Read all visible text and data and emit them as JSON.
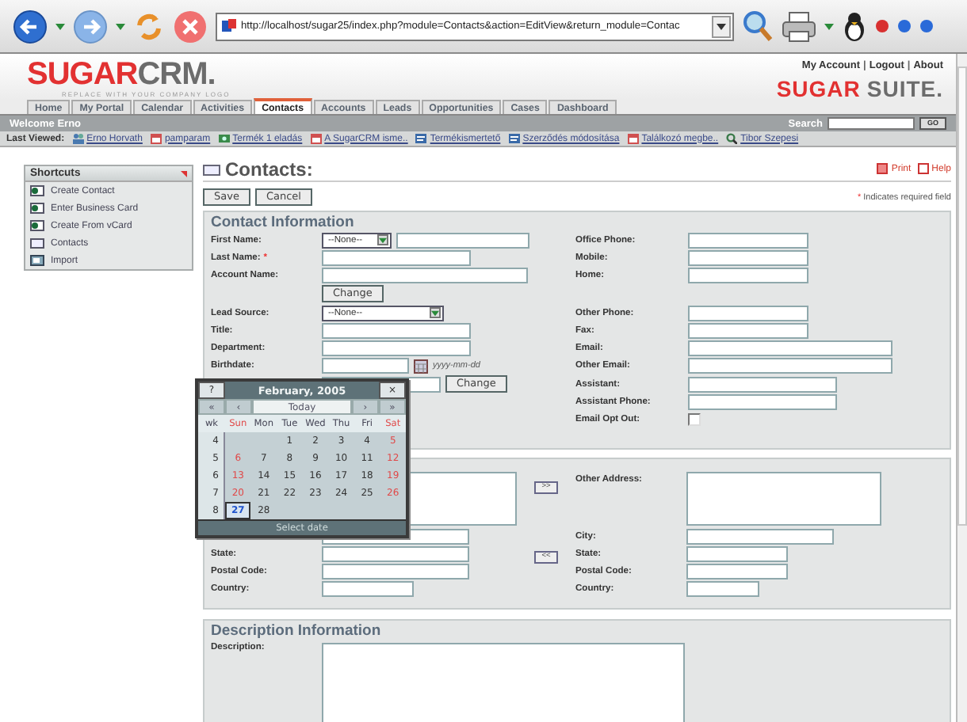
{
  "browser": {
    "url": "http://localhost/sugar25/index.php?module=Contacts&action=EditView&return_module=Contac"
  },
  "header": {
    "logo": {
      "accent": "SUGAR",
      "rest": "CRM."
    },
    "tagline": "REPLACE WITH YOUR COMPANY LOGO",
    "links": [
      "My Account",
      "Logout",
      "About"
    ],
    "separator": "|",
    "suite_logo": {
      "accent": "SUGAR",
      "rest": "SUITE."
    }
  },
  "tabs": [
    {
      "label": "Home",
      "selected": false
    },
    {
      "label": "My Portal",
      "selected": false
    },
    {
      "label": "Calendar",
      "selected": false
    },
    {
      "label": "Activities",
      "selected": false
    },
    {
      "label": "Contacts",
      "selected": true
    },
    {
      "label": "Accounts",
      "selected": false
    },
    {
      "label": "Leads",
      "selected": false
    },
    {
      "label": "Opportunities",
      "selected": false
    },
    {
      "label": "Cases",
      "selected": false
    },
    {
      "label": "Dashboard",
      "selected": false
    }
  ],
  "welcome": "Welcome Erno",
  "search": {
    "label": "Search",
    "button": "GO"
  },
  "last_viewed": {
    "label": "Last Viewed:",
    "items": [
      {
        "label": "Erno Horvath",
        "kind": "contact"
      },
      {
        "label": "pamparam",
        "kind": "meeting"
      },
      {
        "label": "Termék 1 eladás",
        "kind": "opportunity"
      },
      {
        "label": "A SugarCRM isme..",
        "kind": "meeting"
      },
      {
        "label": "Termékismertető",
        "kind": "note"
      },
      {
        "label": "Szerződés módosítása",
        "kind": "note"
      },
      {
        "label": "Találkozó megbe..",
        "kind": "meeting"
      },
      {
        "label": "Tibor Szepesi",
        "kind": "lead"
      }
    ]
  },
  "shortcuts": {
    "title": "Shortcuts",
    "items": [
      {
        "label": "Create Contact",
        "kind": "create"
      },
      {
        "label": "Enter Business Card",
        "kind": "create"
      },
      {
        "label": "Create From vCard",
        "kind": "create"
      },
      {
        "label": "Contacts",
        "kind": "list"
      },
      {
        "label": "Import",
        "kind": "import"
      }
    ]
  },
  "page": {
    "title": "Contacts:",
    "links": [
      "Print",
      "Help"
    ],
    "buttons": [
      "Save",
      "Cancel"
    ],
    "required_note": {
      "mark": "*",
      "text": "Indicates required field"
    }
  },
  "contact_panel": {
    "title": "Contact Information",
    "rows": [
      {
        "left": {
          "kind": "select_input",
          "label": "First Name:",
          "select": "--None--"
        },
        "right": {
          "kind": "input",
          "label": "Office Phone:"
        }
      },
      {
        "left": {
          "kind": "input",
          "label": "Last Name:",
          "required_mark": "*"
        },
        "right": {
          "kind": "input",
          "label": "Mobile:"
        }
      },
      {
        "left": {
          "kind": "input",
          "label": "Account Name:"
        },
        "right": {
          "kind": "input",
          "label": "Home:"
        }
      },
      {
        "left": {
          "kind": "button",
          "button": "Change"
        }
      },
      {
        "left": {
          "kind": "select",
          "label": "Lead Source:",
          "select": "--None--"
        },
        "right": {
          "kind": "input",
          "label": "Other Phone:"
        }
      },
      {
        "left": {
          "kind": "input",
          "label": "Title:"
        },
        "right": {
          "kind": "input",
          "label": "Fax:"
        }
      },
      {
        "left": {
          "kind": "input",
          "label": "Department:"
        },
        "right": {
          "kind": "input",
          "label": "Email:"
        }
      },
      {
        "left": {
          "kind": "date",
          "label": "Birthdate:",
          "hint": "yyyy-mm-dd"
        },
        "right": {
          "kind": "input",
          "label": "Other Email:"
        }
      },
      {
        "left": {
          "kind": "input_button",
          "button": "Change"
        },
        "right": {
          "kind": "input",
          "label": "Assistant:"
        }
      },
      {
        "right": {
          "kind": "input",
          "label": "Assistant Phone:"
        }
      },
      {
        "right": {
          "kind": "checkbox",
          "label": "Email Opt Out:",
          "checked": false
        }
      }
    ]
  },
  "address_panel": {
    "left": [
      {
        "kind": "textarea"
      },
      {
        "kind": "input"
      },
      {
        "kind": "input",
        "label": "State:"
      },
      {
        "kind": "input",
        "label": "Postal Code:"
      },
      {
        "kind": "input",
        "label": "Country:"
      }
    ],
    "copy_buttons": [
      ">>",
      "<<"
    ],
    "right": [
      {
        "kind": "textarea",
        "label": "Other Address:"
      },
      {
        "kind": "input",
        "label": "City:"
      },
      {
        "kind": "input",
        "label": "State:"
      },
      {
        "kind": "input",
        "label": "Postal Code:"
      },
      {
        "kind": "input",
        "label": "Country:"
      }
    ]
  },
  "description_panel": {
    "title": "Description Information",
    "label": "Description:"
  },
  "calendar": {
    "help": "?",
    "title": "February, 2005",
    "close": "×",
    "nav": [
      "«",
      "‹",
      "Today",
      "›",
      "»"
    ],
    "weekdays": [
      {
        "label": "wk",
        "weekend": false
      },
      {
        "label": "Sun",
        "weekend": true
      },
      {
        "label": "Mon",
        "weekend": false
      },
      {
        "label": "Tue",
        "weekend": false
      },
      {
        "label": "Wed",
        "weekend": false
      },
      {
        "label": "Thu",
        "weekend": false
      },
      {
        "label": "Fri",
        "weekend": false
      },
      {
        "label": "Sat",
        "weekend": true
      }
    ],
    "weeks": [
      {
        "number": "4",
        "days": [
          {
            "kind": "blank"
          },
          {
            "kind": "blank"
          },
          {
            "kind": "day",
            "label": "1",
            "weekend": false,
            "selected": false
          },
          {
            "kind": "day",
            "label": "2",
            "weekend": false,
            "selected": false
          },
          {
            "kind": "day",
            "label": "3",
            "weekend": false,
            "selected": false
          },
          {
            "kind": "day",
            "label": "4",
            "weekend": false,
            "selected": false
          },
          {
            "kind": "day",
            "label": "5",
            "weekend": true,
            "selected": false
          }
        ]
      },
      {
        "number": "5",
        "days": [
          {
            "kind": "day",
            "label": "6",
            "weekend": true,
            "selected": false
          },
          {
            "kind": "day",
            "label": "7",
            "weekend": false,
            "selected": false
          },
          {
            "kind": "day",
            "label": "8",
            "weekend": false,
            "selected": false
          },
          {
            "kind": "day",
            "label": "9",
            "weekend": false,
            "selected": false
          },
          {
            "kind": "day",
            "label": "10",
            "weekend": false,
            "selected": false
          },
          {
            "kind": "day",
            "label": "11",
            "weekend": false,
            "selected": false
          },
          {
            "kind": "day",
            "label": "12",
            "weekend": true,
            "selected": false
          }
        ]
      },
      {
        "number": "6",
        "days": [
          {
            "kind": "day",
            "label": "13",
            "weekend": true,
            "selected": false
          },
          {
            "kind": "day",
            "label": "14",
            "weekend": false,
            "selected": false
          },
          {
            "kind": "day",
            "label": "15",
            "weekend": false,
            "selected": false
          },
          {
            "kind": "day",
            "label": "16",
            "weekend": false,
            "selected": false
          },
          {
            "kind": "day",
            "label": "17",
            "weekend": false,
            "selected": false
          },
          {
            "kind": "day",
            "label": "18",
            "weekend": false,
            "selected": false
          },
          {
            "kind": "day",
            "label": "19",
            "weekend": true,
            "selected": false
          }
        ]
      },
      {
        "number": "7",
        "days": [
          {
            "kind": "day",
            "label": "20",
            "weekend": true,
            "selected": false
          },
          {
            "kind": "day",
            "label": "21",
            "weekend": false,
            "selected": false
          },
          {
            "kind": "day",
            "label": "22",
            "weekend": false,
            "selected": false
          },
          {
            "kind": "day",
            "label": "23",
            "weekend": false,
            "selected": false
          },
          {
            "kind": "day",
            "label": "24",
            "weekend": false,
            "selected": false
          },
          {
            "kind": "day",
            "label": "25",
            "weekend": false,
            "selected": false
          },
          {
            "kind": "day",
            "label": "26",
            "weekend": true,
            "selected": false
          }
        ]
      },
      {
        "number": "8",
        "days": [
          {
            "kind": "day",
            "label": "27",
            "weekend": false,
            "selected": true
          },
          {
            "kind": "day",
            "label": "28",
            "weekend": false,
            "selected": false
          }
        ]
      }
    ],
    "footer": "Select date"
  }
}
